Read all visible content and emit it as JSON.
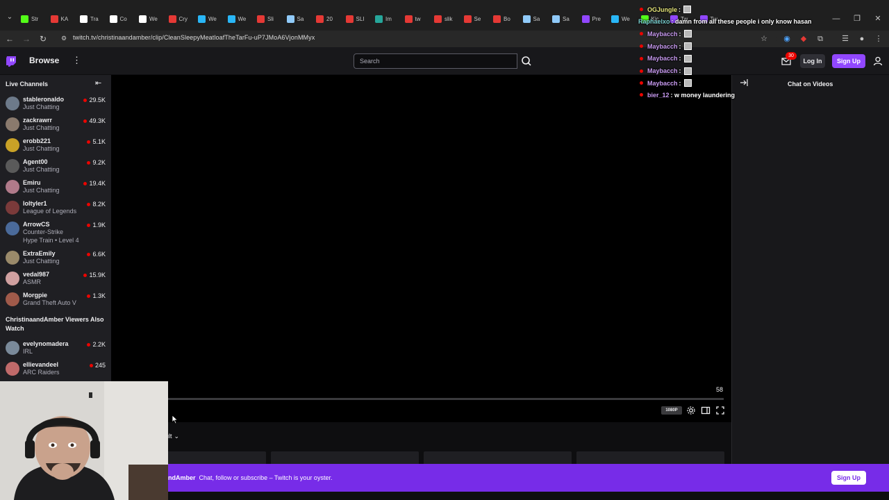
{
  "browser": {
    "tabs": [
      {
        "label": "Str",
        "color": "#53fc18"
      },
      {
        "label": "KA",
        "color": "#e53935"
      },
      {
        "label": "Tra",
        "color": "#ffffff"
      },
      {
        "label": "Co",
        "color": "#ffffff"
      },
      {
        "label": "We",
        "color": "#ffffff"
      },
      {
        "label": "Cry",
        "color": "#e53935"
      },
      {
        "label": "We",
        "color": "#29b6f6"
      },
      {
        "label": "We",
        "color": "#29b6f6"
      },
      {
        "label": "Sli",
        "color": "#e53935"
      },
      {
        "label": "Sa",
        "color": "#90caf9"
      },
      {
        "label": "20",
        "color": "#e53935"
      },
      {
        "label": "SLI",
        "color": "#e53935"
      },
      {
        "label": "Im",
        "color": "#26a69a"
      },
      {
        "label": "tw",
        "color": "#e53935"
      },
      {
        "label": "slik",
        "color": "#e53935"
      },
      {
        "label": "Se",
        "color": "#e53935"
      },
      {
        "label": "Bo",
        "color": "#e53935"
      },
      {
        "label": "Sa",
        "color": "#90caf9"
      },
      {
        "label": "Sa",
        "color": "#90caf9"
      },
      {
        "label": "Pre",
        "color": "#9147ff"
      },
      {
        "label": "We",
        "color": "#29b6f6"
      },
      {
        "label": "Kic",
        "color": "#53fc18"
      },
      {
        "label": "Tw",
        "color": "#9147ff"
      },
      {
        "label": "Tw",
        "color": "#9147ff"
      }
    ],
    "url": "twitch.tv/christinaandamber/clip/CleanSleepyMeatloafTheTarFu-uP7JMoA6VjonMMyx"
  },
  "topnav": {
    "browse": "Browse",
    "search_placeholder": "Search",
    "notification_count": "30",
    "login": "Log In",
    "signup": "Sign Up"
  },
  "sidebar": {
    "title": "Live Channels",
    "channels": [
      {
        "name": "stableronaldo",
        "game": "Just Chatting",
        "viewers": "29.5K",
        "avatar_color": "#6d7a8a"
      },
      {
        "name": "zackrawrr",
        "game": "Just Chatting",
        "viewers": "49.3K",
        "avatar_color": "#8a7a6d"
      },
      {
        "name": "erobb221",
        "game": "Just Chatting",
        "viewers": "5.1K",
        "avatar_color": "#c9a227"
      },
      {
        "name": "Agent00",
        "game": "Just Chatting",
        "viewers": "9.2K",
        "avatar_color": "#5a5a5a"
      },
      {
        "name": "Emiru",
        "game": "Just Chatting",
        "viewers": "19.4K",
        "avatar_color": "#b07a8a"
      },
      {
        "name": "loltyler1",
        "game": "League of Legends",
        "viewers": "8.2K",
        "avatar_color": "#7a3a3a"
      },
      {
        "name": "ArrowCS",
        "game": "Counter-Strike",
        "extra": "Hype Train • Level 4",
        "viewers": "1.9K",
        "avatar_color": "#4a6a9a"
      },
      {
        "name": "ExtraEmily",
        "game": "Just Chatting",
        "viewers": "6.6K",
        "avatar_color": "#9a8a6a"
      },
      {
        "name": "vedal987",
        "game": "ASMR",
        "viewers": "15.9K",
        "avatar_color": "#d0a0a0"
      },
      {
        "name": "Morgpie",
        "game": "Grand Theft Auto V",
        "viewers": "1.3K",
        "avatar_color": "#a05a4a"
      }
    ],
    "also_watch_title": "ChristinaandAmber Viewers Also Watch",
    "also_watch": [
      {
        "name": "evelynomadera",
        "game": "IRL",
        "viewers": "2.2K",
        "avatar_color": "#7a8a9a"
      },
      {
        "name": "ellievandeel",
        "game": "ARC Raiders",
        "viewers": "245",
        "avatar_color": "#c06a6a"
      }
    ]
  },
  "player": {
    "time": "58",
    "quality": "1080P",
    "sort_label": "ult"
  },
  "chat_column": {
    "title": "Chat on Videos"
  },
  "overlay_chat": [
    {
      "user": "OGJungle",
      "color": "#e6e67a",
      "text": ":",
      "emote": true
    },
    {
      "user": "Raphaelxo",
      "color": "#7ad0d0",
      "text": ": damn from all these people i only know hasan",
      "emote": false
    },
    {
      "user": "Maybacch",
      "color": "#c89af0",
      "text": ":",
      "emote": true
    },
    {
      "user": "Maybacch",
      "color": "#c89af0",
      "text": ":",
      "emote": true
    },
    {
      "user": "Maybacch",
      "color": "#c89af0",
      "text": ":",
      "emote": true
    },
    {
      "user": "Maybacch",
      "color": "#c89af0",
      "text": ":",
      "emote": true
    },
    {
      "user": "Maybacch",
      "color": "#c89af0",
      "text": ":",
      "emote": true
    },
    {
      "user": "bier_12",
      "color": "#c89af0",
      "text": ": w money laundering",
      "emote": false
    }
  ],
  "banner": {
    "channel": "ndAmber",
    "text": "Chat, follow or subscribe – Twitch is your oyster.",
    "signup": "Sign Up"
  },
  "colors": {
    "brand": "#9147ff",
    "banner": "#772ce8",
    "live": "#eb0400"
  }
}
